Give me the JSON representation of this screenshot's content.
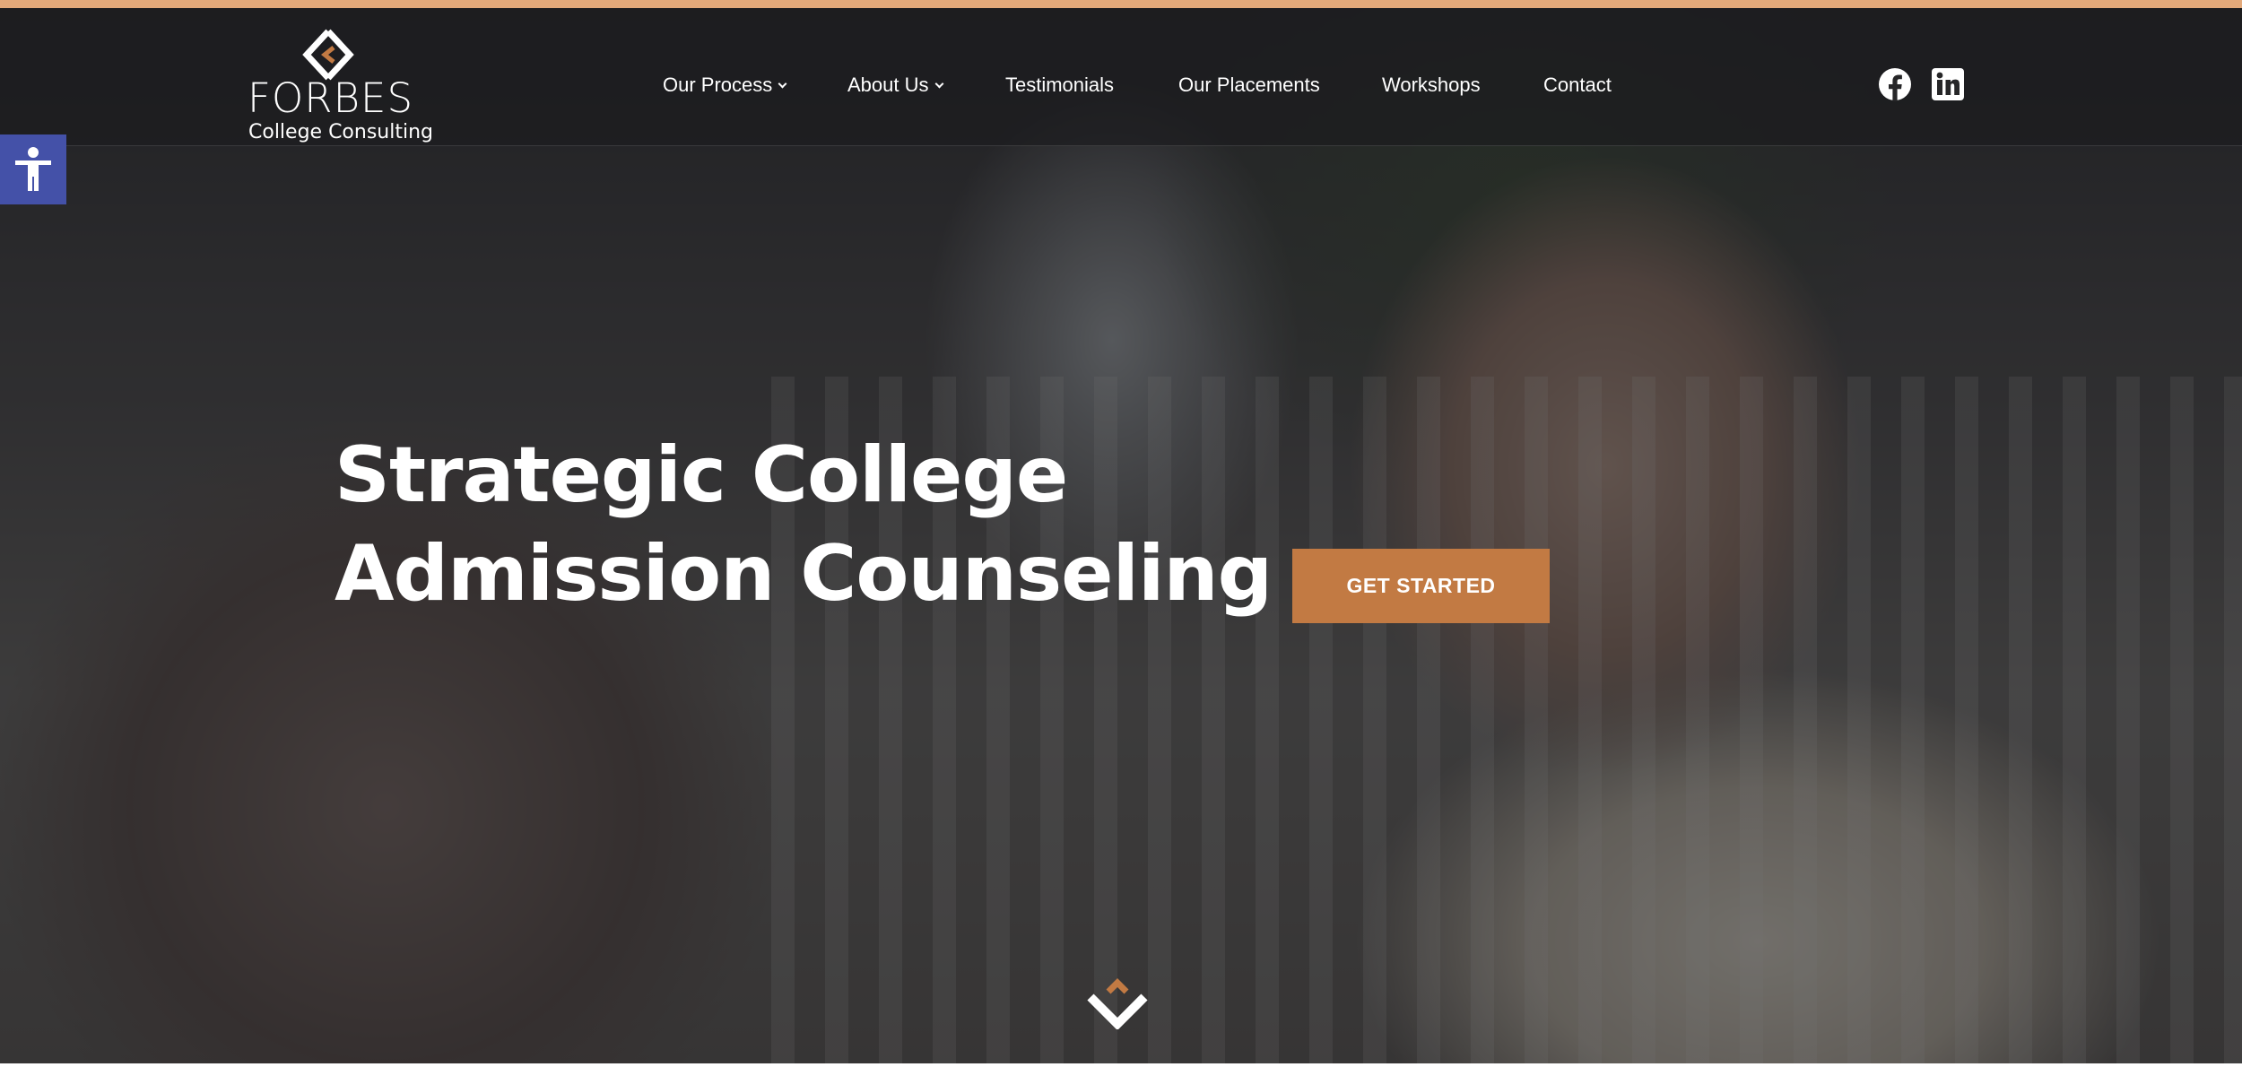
{
  "brand": {
    "name": "FORBES",
    "subtitle": "College Consulting",
    "accent_color": "#c27a43",
    "top_bar_color": "#e3a97a",
    "logo_icon": "diamond-chevron-logo-icon"
  },
  "nav": {
    "items": [
      {
        "label": "Our Process",
        "has_dropdown": true
      },
      {
        "label": "About Us",
        "has_dropdown": true
      },
      {
        "label": "Testimonials",
        "has_dropdown": false
      },
      {
        "label": "Our Placements",
        "has_dropdown": false
      },
      {
        "label": "Workshops",
        "has_dropdown": false
      },
      {
        "label": "Contact",
        "has_dropdown": false
      }
    ]
  },
  "social": [
    {
      "icon": "facebook-icon"
    },
    {
      "icon": "linkedin-icon"
    }
  ],
  "accessibility": {
    "icon": "accessibility-person-icon",
    "color": "#4451a8"
  },
  "hero": {
    "title_line_1": "Strategic College",
    "title_line_2": "Admission Counseling",
    "cta_label": "GET STARTED",
    "scroll_icon": "scroll-down-chevron-icon"
  }
}
